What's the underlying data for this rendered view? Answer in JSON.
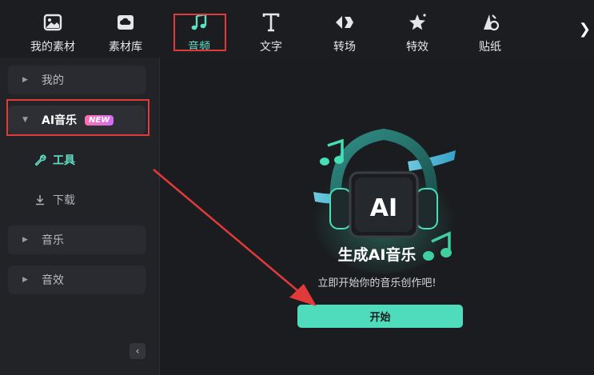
{
  "toolbar": {
    "tabs": [
      {
        "label": "我的素材",
        "icon": "image-icon"
      },
      {
        "label": "素材库",
        "icon": "cloud-box-icon"
      },
      {
        "label": "音频",
        "icon": "music-note-icon",
        "active": true
      },
      {
        "label": "文字",
        "icon": "text-icon"
      },
      {
        "label": "转场",
        "icon": "transition-icon"
      },
      {
        "label": "特效",
        "icon": "effects-star-icon"
      },
      {
        "label": "贴纸",
        "icon": "sticker-icon"
      }
    ],
    "more_glyph": "❯"
  },
  "sidebar": {
    "items": [
      {
        "label": "我的"
      },
      {
        "label": "AI音乐",
        "badge": "NEW",
        "expanded": true
      },
      {
        "label": "音乐"
      },
      {
        "label": "音效"
      }
    ],
    "sub_items": [
      {
        "label": "工具",
        "active": true
      },
      {
        "label": "下载"
      }
    ],
    "collapse_glyph": "‹"
  },
  "main": {
    "title": "生成AI音乐",
    "subtitle": "立即开始你的音乐创作吧!",
    "start_button": "开始",
    "hero_badge": "AI"
  },
  "colors": {
    "accent": "#4fdcbd",
    "annotation": "#e03a3a",
    "background": "#1b1c20",
    "sidebar": "#222327"
  }
}
